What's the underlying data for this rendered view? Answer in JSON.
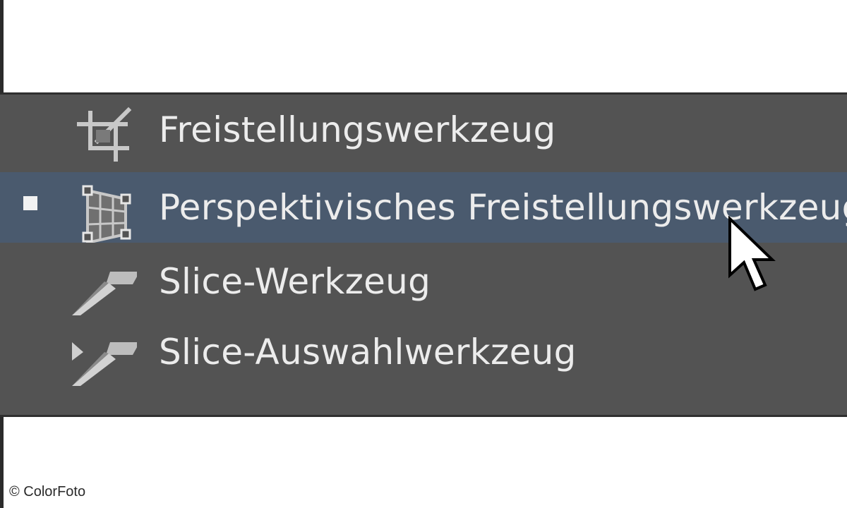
{
  "menu": {
    "items": [
      {
        "label": "Freistellungswerkzeug",
        "icon": "crop-icon",
        "selected": false
      },
      {
        "label": "Perspektivisches Freistellungswerkzeug",
        "icon": "perspective-crop-icon",
        "selected": true
      },
      {
        "label": "Slice-Werkzeug",
        "icon": "slice-icon",
        "selected": false
      },
      {
        "label": "Slice-Auswahlwerkzeug",
        "icon": "slice-select-icon",
        "selected": false
      }
    ]
  },
  "watermark": "© ColorFoto",
  "colors": {
    "panel": "#535353",
    "selected_row": "#4a5a6e",
    "text": "#ececec",
    "border": "#2f2f2f"
  }
}
